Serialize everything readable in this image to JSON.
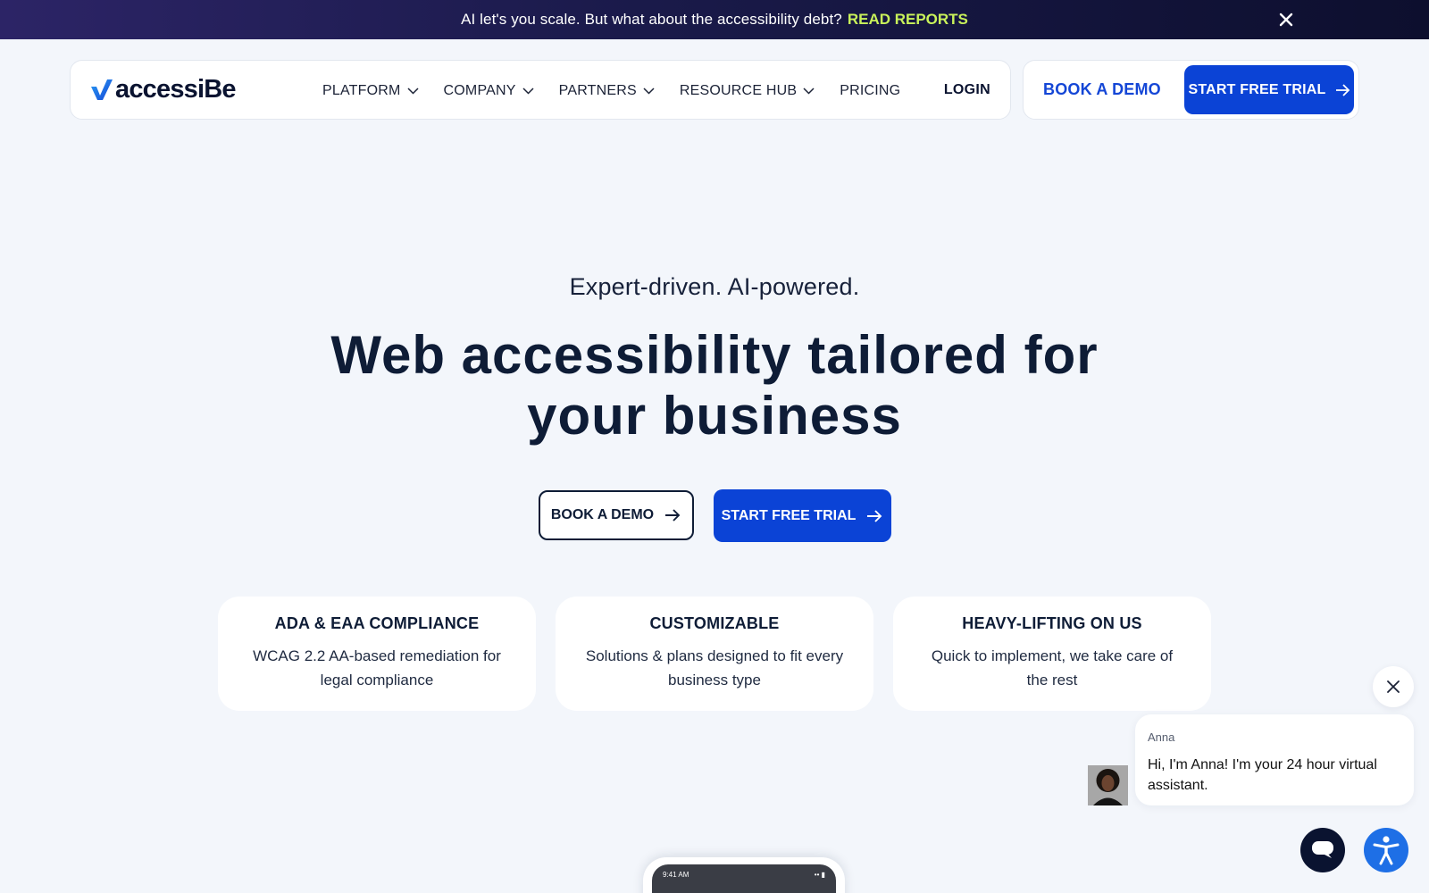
{
  "announcement": {
    "message": "AI let's you scale. But what about the accessibility debt?",
    "cta": "READ REPORTS"
  },
  "nav": {
    "logo_text": "accessiBe",
    "items": [
      {
        "label": "PLATFORM",
        "has_dropdown": true
      },
      {
        "label": "COMPANY",
        "has_dropdown": true
      },
      {
        "label": "PARTNERS",
        "has_dropdown": true
      },
      {
        "label": "RESOURCE HUB",
        "has_dropdown": true
      },
      {
        "label": "PRICING",
        "has_dropdown": false
      }
    ],
    "login": "LOGIN",
    "book_demo": "BOOK A DEMO",
    "start_trial": "START FREE TRIAL"
  },
  "hero": {
    "eyebrow": "Expert-driven. AI-powered.",
    "headline_line1": "Web accessibility tailored for",
    "headline_line2": "your business",
    "book_demo": "BOOK A DEMO",
    "start_trial": "START FREE TRIAL"
  },
  "features": [
    {
      "title": "ADA & EAA COMPLIANCE",
      "desc": "WCAG 2.2 AA-based remediation for legal compliance"
    },
    {
      "title": "CUSTOMIZABLE",
      "desc": "Solutions & plans designed to fit every business type"
    },
    {
      "title": "HEAVY-LIFTING ON US",
      "desc": "Quick to implement, we take care of the rest"
    }
  ],
  "chat": {
    "agent_name": "Anna",
    "message": "Hi, I'm Anna! I'm your 24 hour virtual assistant."
  },
  "phone": {
    "time": "9:41 AM"
  },
  "colors": {
    "primary": "#0b43d6",
    "accent": "#c9f25a",
    "text": "#0e1c36",
    "background": "#f3f6fb",
    "a11y": "#1e6fe6"
  }
}
